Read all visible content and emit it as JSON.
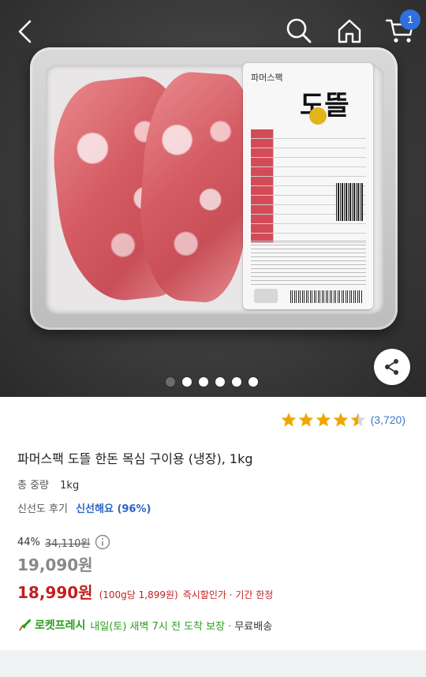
{
  "header": {
    "cart_count": "1",
    "icons": [
      "back-icon",
      "search-icon",
      "home-icon",
      "cart-icon"
    ]
  },
  "gallery": {
    "package_label": {
      "brand": "파머스팩",
      "title": "도뜰"
    },
    "dots": [
      {
        "active": false
      },
      {
        "active": true
      },
      {
        "active": true
      },
      {
        "active": true
      },
      {
        "active": true
      },
      {
        "active": true
      }
    ],
    "share_icon": "share-icon"
  },
  "product": {
    "rating": 4.5,
    "review_count": "(3,720)",
    "title": "파머스팩 도뜰 한돈 목심 구이용 (냉장), 1kg",
    "weight_label": "총 중량",
    "weight_value": "1kg",
    "freshness_label": "신선도 후기",
    "freshness_value": "신선해요 (96%)",
    "discount_rate": "44%",
    "original_price": "34,110원",
    "sale_price": "19,090원",
    "instant_price": "18,990원",
    "unit_price": "(100g당 1,899원)",
    "instant_label": "즉시할인가 · 기간 한정"
  },
  "delivery": {
    "brand": "로켓프레시",
    "text": "내일(토) 새벽 7시 전 도착 보장 ·",
    "shipping": "무료배송"
  },
  "colors": {
    "accent_blue": "#2a66c8",
    "price_red": "#c21f1f",
    "rocket_green": "#2a9d1e",
    "star_gold": "#f0a500",
    "badge_blue": "#2f6fe0"
  }
}
